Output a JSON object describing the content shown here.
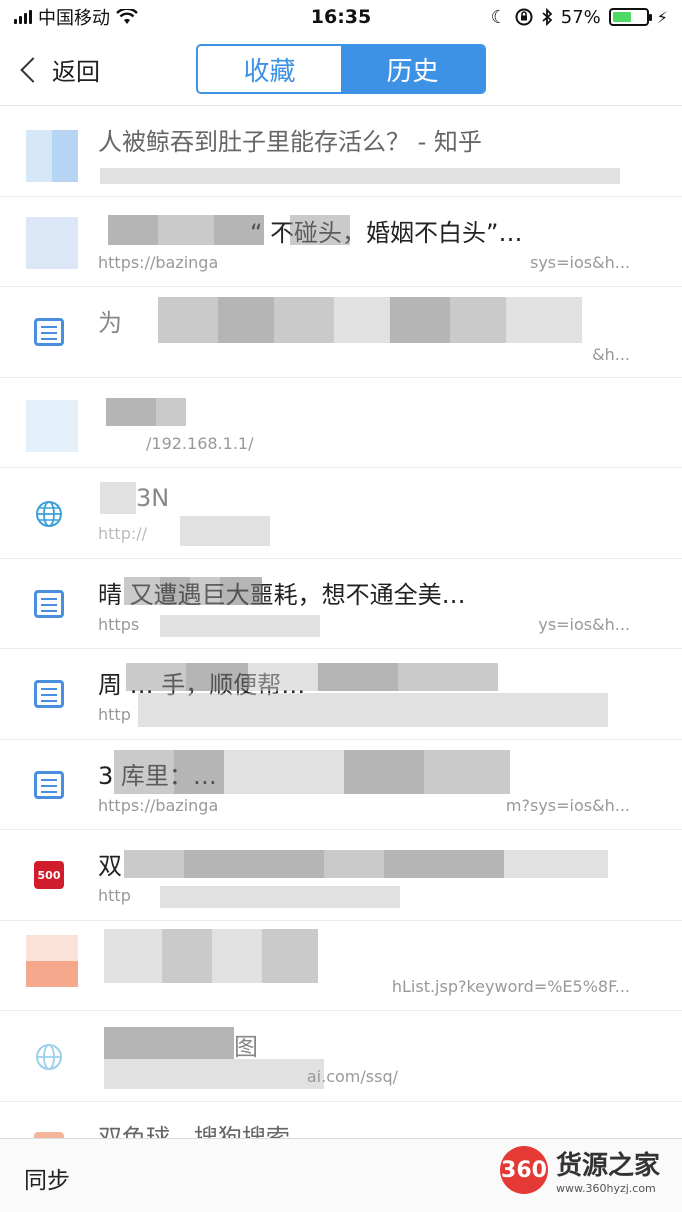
{
  "status_bar": {
    "carrier": "中国移动",
    "time": "16:35",
    "battery_percent": "57%",
    "battery_level": 0.57
  },
  "nav": {
    "back_label": "返回",
    "tabs": [
      {
        "label": "收藏",
        "selected": false
      },
      {
        "label": "历史",
        "selected": true
      }
    ]
  },
  "list": {
    "items": [
      {
        "title": "人被鲸吞到肚子里能存活么？ - 知乎",
        "url": "",
        "url_right": "",
        "icon": "blurred-favicon"
      },
      {
        "title": "“ 不碰头，婚姻不白头”…",
        "url": "https://bazinga",
        "url_right": "sys=ios&h...",
        "icon": "blurred-favicon"
      },
      {
        "title": "为",
        "url": "",
        "url_right": "&h...",
        "icon": "document-icon"
      },
      {
        "title": "",
        "url": "/192.168.1.1/",
        "url_right": "",
        "icon": "blurred-favicon"
      },
      {
        "title": "3N",
        "url": "http://",
        "url_right": "",
        "icon": "globe-icon"
      },
      {
        "title": "晴 又遭遇巨大噩耗，想不通全美…",
        "url": "https",
        "url_right": "ys=ios&h...",
        "icon": "document-icon"
      },
      {
        "title": "周 … 手，顺便帮…",
        "url": "http",
        "url_right": "",
        "icon": "document-icon"
      },
      {
        "title": "3 库里：…",
        "url": "https://bazinga",
        "url_right": "m?sys=ios&h...",
        "icon": "document-icon"
      },
      {
        "title": "双",
        "url": "http",
        "url_right": "",
        "icon": "500-logo-icon"
      },
      {
        "title": "",
        "url": "",
        "url_right": "hList.jsp?keyword=%E5%8F...",
        "icon": "blurred-favicon"
      },
      {
        "title": "图",
        "url": "",
        "url_right": "ai.com/ssq/",
        "icon": "globe-icon"
      },
      {
        "title": "双色球 - 搜狗搜索",
        "url": "",
        "url_right": "",
        "icon": "blurred-favicon"
      }
    ]
  },
  "bottom": {
    "sync_label": "同步"
  },
  "watermark": {
    "logo": "360",
    "name": "货源之家",
    "url": "www.360hyzj.com"
  },
  "colors": {
    "accent": "#3d92e6",
    "battery": "#4cd964",
    "watermark_red": "#e53935"
  }
}
